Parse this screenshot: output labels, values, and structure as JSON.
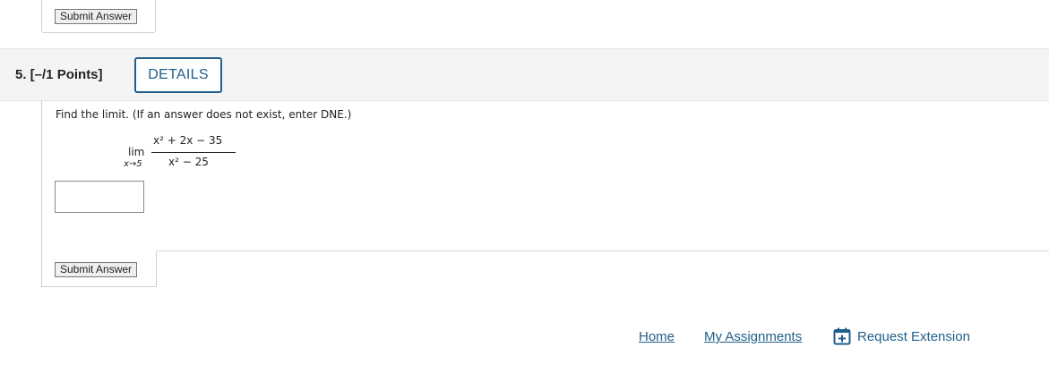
{
  "top_panel": {
    "submit_label": "Submit Answer"
  },
  "question": {
    "label": "5.  [–/1 Points]",
    "details_label": "DETAILS",
    "prompt": "Find the limit. (If an answer does not exist, enter DNE.)",
    "limit_word": "lim",
    "limit_sub": "x→5",
    "numerator": "x² + 2x − 35",
    "denominator": "x² − 25",
    "answer_value": "",
    "submit_label": "Submit Answer"
  },
  "footer": {
    "home": "Home",
    "my_assignments": "My Assignments",
    "request_extension": "Request Extension",
    "extension_icon": "calendar-plus-icon"
  },
  "colors": {
    "link": "#1f5f8b",
    "header_bg": "#f4f4f4"
  }
}
